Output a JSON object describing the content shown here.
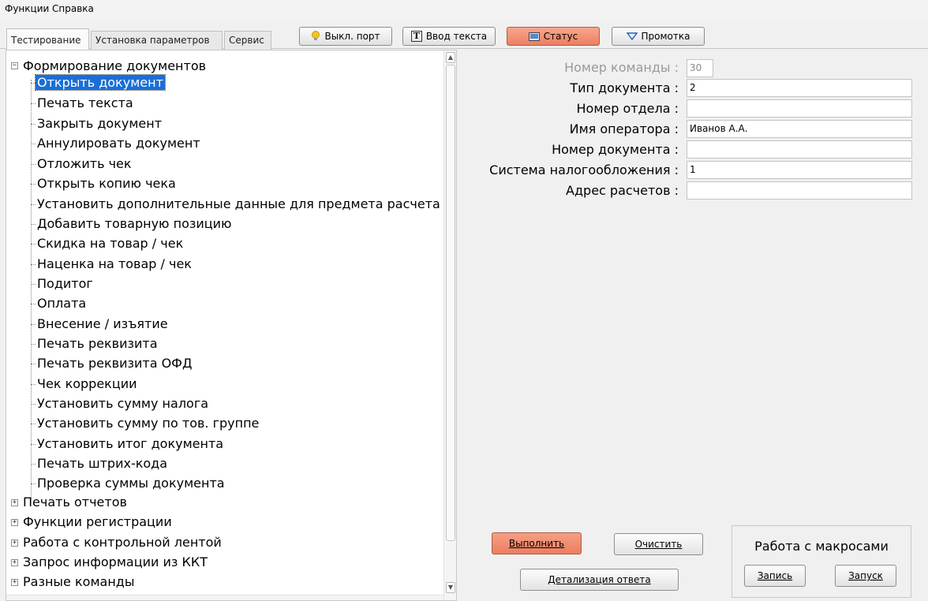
{
  "menu": [
    "Функции",
    "Справка"
  ],
  "tabs": [
    {
      "label": "Тестирование",
      "active": true
    },
    {
      "label": "Установка параметров",
      "active": false
    },
    {
      "label": "Сервис",
      "active": false
    }
  ],
  "toolbar": {
    "port_label": "Выкл. порт",
    "text_input_label": "Ввод текста",
    "status_label": "Статус",
    "feed_label": "Промотка"
  },
  "tree": {
    "group_open": "Формирование документов",
    "children": [
      "Открыть документ",
      "Печать текста",
      "Закрыть документ",
      "Аннулировать документ",
      "Отложить чек",
      "Открыть копию чека",
      "Установить дополнительные данные для предмета расчета",
      "Добавить товарную позицию",
      "Скидка на товар / чек",
      "Наценка на товар / чек",
      "Подитог",
      "Оплата",
      "Внесение / изъятие",
      "Печать реквизита",
      "Печать реквизита ОФД",
      "Чек коррекции",
      "Установить сумму налога",
      "Установить сумму по тов. группе",
      "Установить итог документа",
      "Печать штрих-кода",
      "Проверка суммы документа"
    ],
    "selected": "Открыть документ",
    "groups_collapsed": [
      "Печать отчетов",
      "Функции регистрации",
      "Работа с контрольной лентой",
      "Запрос информации из ККТ",
      "Разные команды"
    ]
  },
  "form": {
    "command_number_label": "Номер команды :",
    "command_number_value": "30",
    "fields": [
      {
        "label": "Тип документа :",
        "value": "2"
      },
      {
        "label": "Номер отдела :",
        "value": ""
      },
      {
        "label": "Имя оператора :",
        "value": "Иванов А.А."
      },
      {
        "label": "Номер документа :",
        "value": ""
      },
      {
        "label": "Система налогообложения :",
        "value": "1"
      },
      {
        "label": "Адрес расчетов :",
        "value": ""
      }
    ]
  },
  "actions": {
    "execute_label": "Выполнить",
    "clear_label": "Очистить",
    "details_label": "Детализация ответа"
  },
  "macros": {
    "title": "Работа с макросами",
    "record_label": "Запись",
    "run_label": "Запуск"
  },
  "colors": {
    "accent_button": "#ec7e62",
    "selection": "#1a6fd6"
  }
}
